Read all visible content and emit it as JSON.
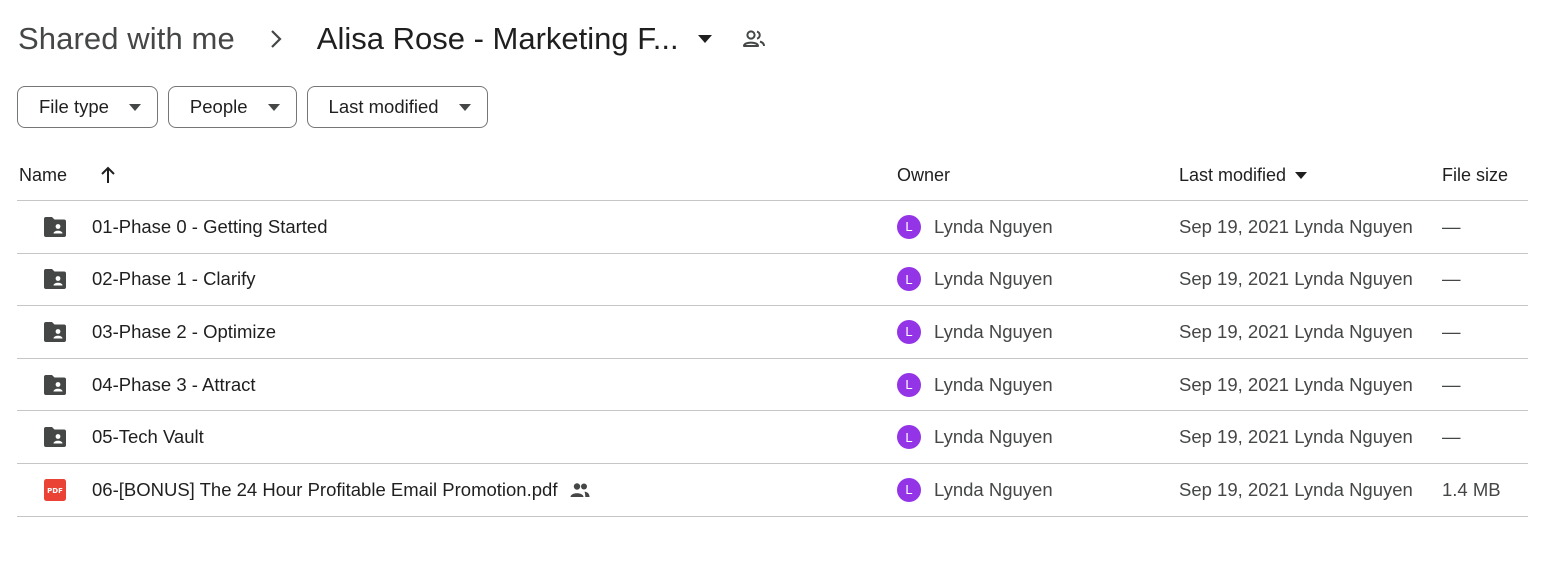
{
  "breadcrumb": {
    "root": "Shared with me",
    "current": "Alisa Rose - Marketing F...",
    "separator_icon": "chevron-right-icon",
    "caret_icon": "arrow-drop-down-icon",
    "shared_icon": "people-icon"
  },
  "filters": [
    {
      "label": "File type"
    },
    {
      "label": "People"
    },
    {
      "label": "Last modified"
    }
  ],
  "table": {
    "headers": {
      "name": "Name",
      "owner": "Owner",
      "last_modified": "Last modified",
      "file_size": "File size"
    },
    "rows": [
      {
        "type": "shared-folder",
        "name": "01-Phase 0 - Getting Started",
        "owner": "Lynda Nguyen",
        "owner_initial": "L",
        "modified": "Sep 19, 2021 Lynda Nguyen",
        "size": "—",
        "shared": false
      },
      {
        "type": "shared-folder",
        "name": "02-Phase 1 - Clarify",
        "owner": "Lynda Nguyen",
        "owner_initial": "L",
        "modified": "Sep 19, 2021 Lynda Nguyen",
        "size": "—",
        "shared": false
      },
      {
        "type": "shared-folder",
        "name": "03-Phase 2 - Optimize",
        "owner": "Lynda Nguyen",
        "owner_initial": "L",
        "modified": "Sep 19, 2021 Lynda Nguyen",
        "size": "—",
        "shared": false
      },
      {
        "type": "shared-folder",
        "name": "04-Phase 3 - Attract",
        "owner": "Lynda Nguyen",
        "owner_initial": "L",
        "modified": "Sep 19, 2021 Lynda Nguyen",
        "size": "—",
        "shared": false
      },
      {
        "type": "shared-folder",
        "name": "05-Tech Vault",
        "owner": "Lynda Nguyen",
        "owner_initial": "L",
        "modified": "Sep 19, 2021 Lynda Nguyen",
        "size": "—",
        "shared": false
      },
      {
        "type": "pdf",
        "name": "06-[BONUS] The 24 Hour Profitable Email Promotion.pdf",
        "owner": "Lynda Nguyen",
        "owner_initial": "L",
        "modified": "Sep 19, 2021 Lynda Nguyen",
        "size": "1.4 MB",
        "shared": true
      }
    ]
  },
  "colors": {
    "avatar": "#9334e6",
    "folder": "#444746",
    "pdf": "#ea4335",
    "divider": "#c4c7c5"
  }
}
